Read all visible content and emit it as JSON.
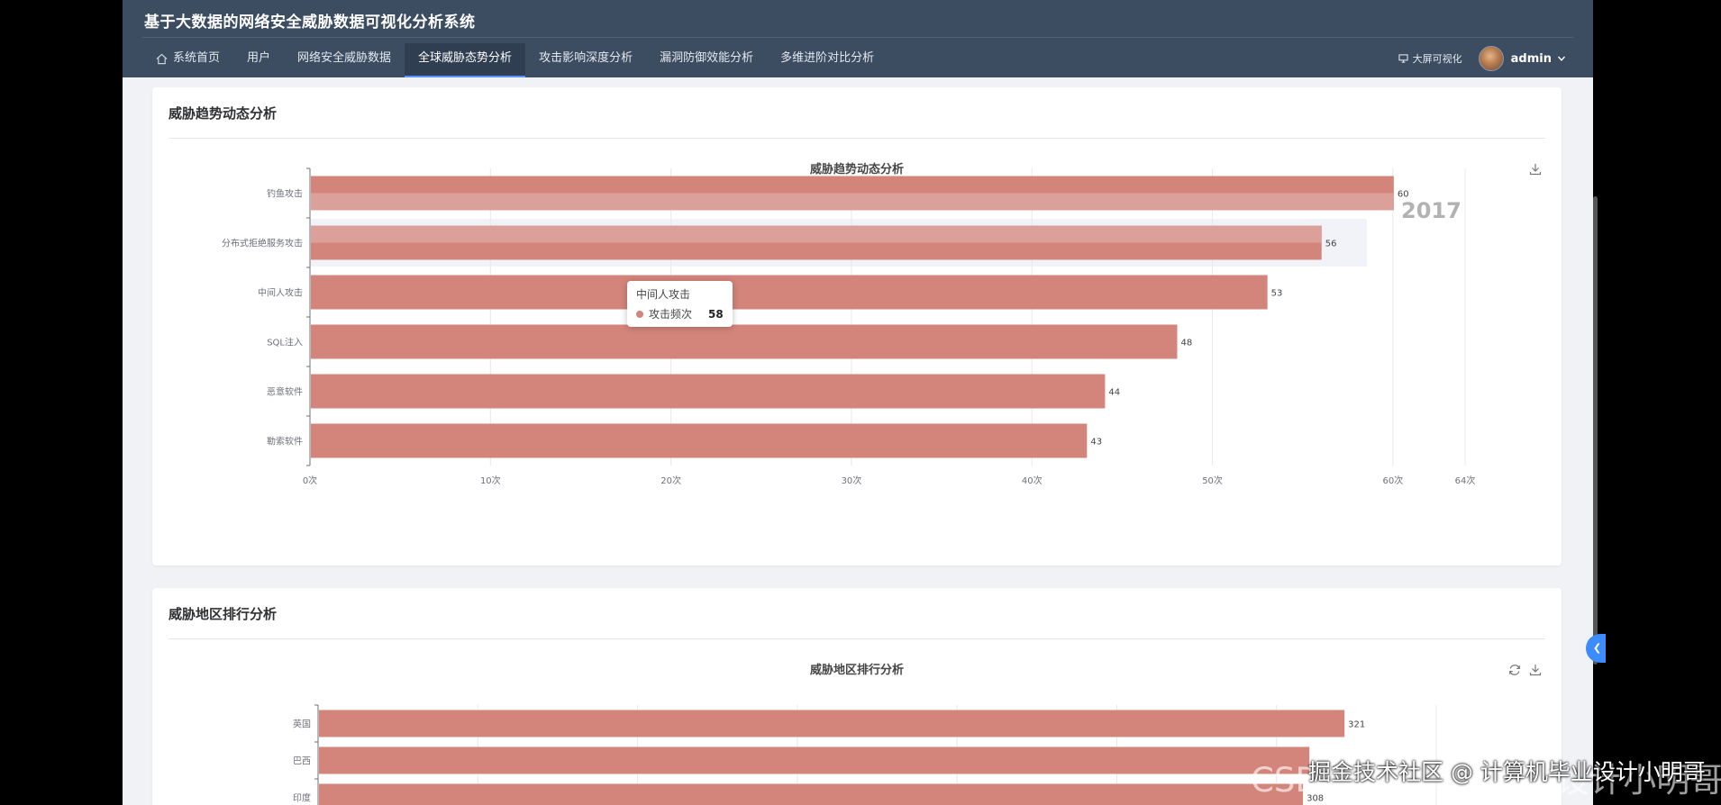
{
  "header": {
    "title": "基于大数据的网络安全威胁数据可视化分析系统",
    "nav": [
      {
        "label": "系统首页",
        "active": false
      },
      {
        "label": "用户",
        "active": false
      },
      {
        "label": "网络安全威胁数据",
        "active": false
      },
      {
        "label": "全球威胁态势分析",
        "active": true
      },
      {
        "label": "攻击影响深度分析",
        "active": false
      },
      {
        "label": "漏洞防御效能分析",
        "active": false
      },
      {
        "label": "多维进阶对比分析",
        "active": false
      }
    ],
    "bigscreen_label": "大屏可视化",
    "user_name": "admin"
  },
  "card1": {
    "title": "威胁趋势动态分析",
    "chart_title": "威胁趋势动态分析",
    "timeline_label": "2017",
    "tooltip": {
      "title": "中间人攻击",
      "series": "攻击频次",
      "value": "58"
    }
  },
  "card2": {
    "title": "威胁地区排行分析",
    "chart_title": "威胁地区排行分析"
  },
  "chart_data": [
    {
      "type": "bar",
      "orientation": "horizontal",
      "title": "威胁趋势动态分析",
      "categories": [
        "钓鱼攻击",
        "分布式拒绝服务攻击",
        "中间人攻击",
        "SQL注入",
        "恶意软件",
        "勒索软件"
      ],
      "values": [
        60,
        56,
        53,
        48,
        44,
        43
      ],
      "xlim": [
        0,
        64
      ],
      "x_ticks": [
        "0次",
        "10次",
        "20次",
        "30次",
        "40次",
        "50次",
        "60次",
        "64次"
      ],
      "color": "#d4857b",
      "highlight_color": "#dba09a",
      "grid": true
    },
    {
      "type": "bar",
      "orientation": "horizontal",
      "title": "威胁地区排行分析",
      "categories": [
        "英国",
        "巴西",
        "印度"
      ],
      "values": [
        321,
        310,
        308
      ],
      "value_labels": [
        "321",
        "",
        "308"
      ],
      "xlim": [
        0,
        350
      ],
      "color": "#d4857b",
      "grid": true
    }
  ],
  "watermark": {
    "main": "CSDN @计算机毕业设计小明哥",
    "overlay": "掘金技术社区 @ 计算机毕业设计小明哥"
  }
}
